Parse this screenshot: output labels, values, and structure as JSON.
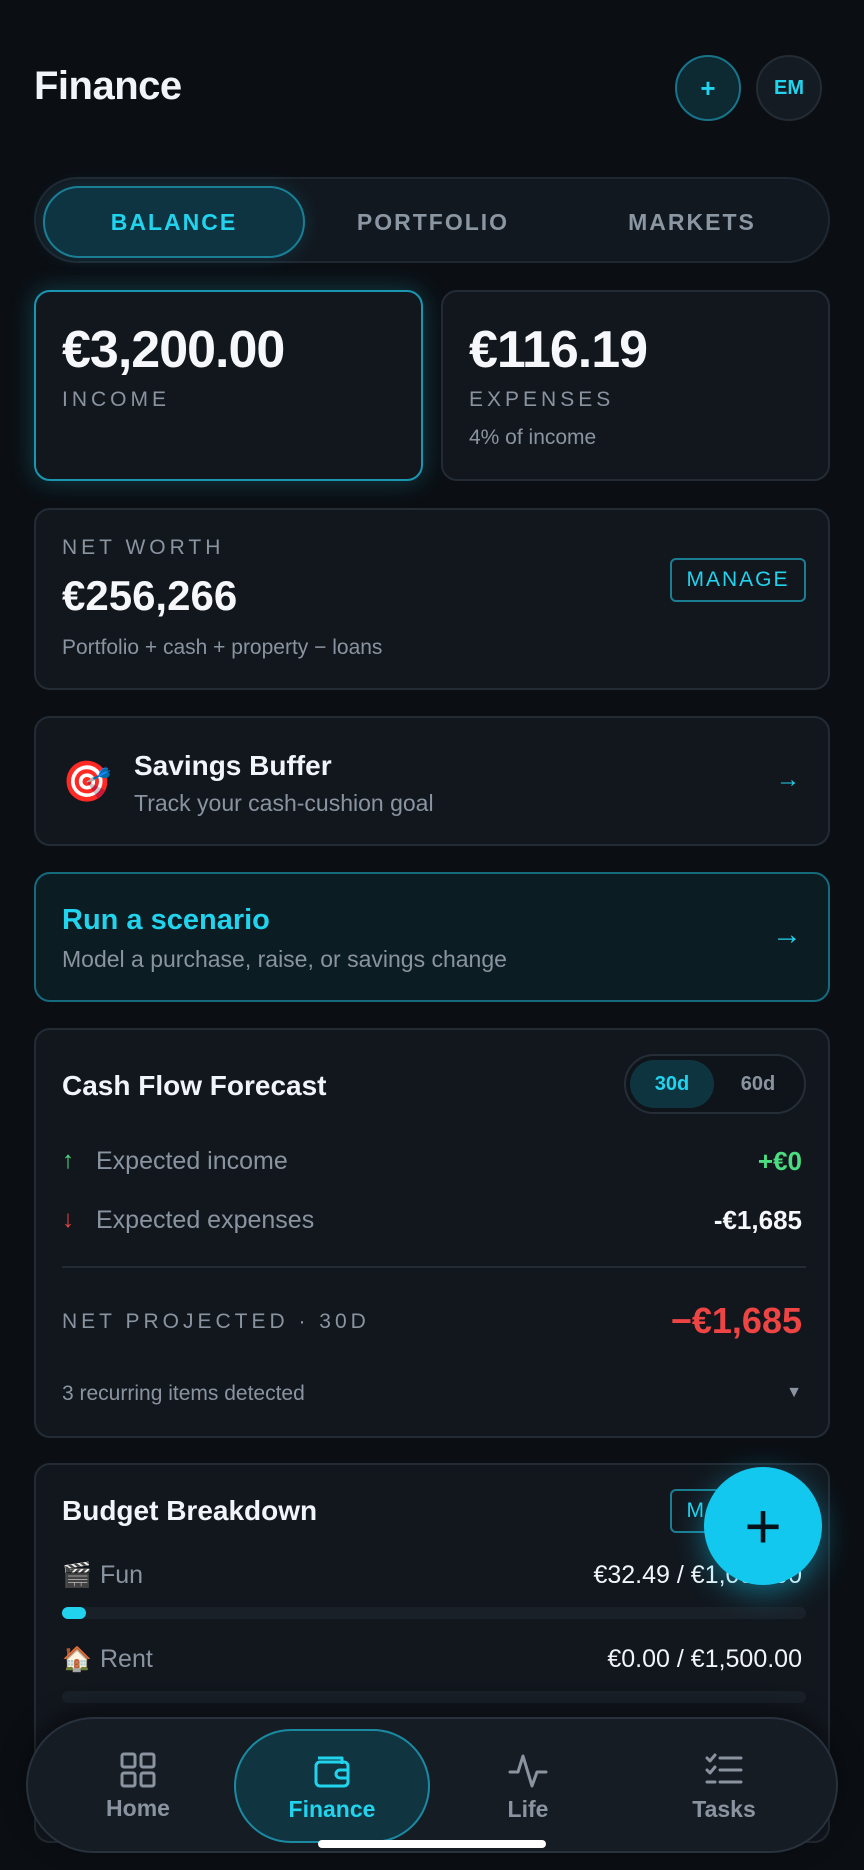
{
  "header": {
    "title": "Finance",
    "add_label": "+",
    "avatar_initials": "EM"
  },
  "tabs": [
    {
      "label": "BALANCE",
      "active": true
    },
    {
      "label": "PORTFOLIO",
      "active": false
    },
    {
      "label": "MARKETS",
      "active": false
    }
  ],
  "income": {
    "amount": "€3,200.00",
    "label": "INCOME"
  },
  "expenses": {
    "amount": "€116.19",
    "label": "EXPENSES",
    "note": "4% of income"
  },
  "net_worth": {
    "label": "NET WORTH",
    "amount": "€256,266",
    "note": "Portfolio + cash + property − loans",
    "manage_label": "MANAGE"
  },
  "savings": {
    "icon": "🎯",
    "title": "Savings Buffer",
    "subtitle": "Track your cash-cushion goal",
    "arrow": "→"
  },
  "scenario": {
    "title": "Run a scenario",
    "subtitle": "Model a purchase, raise, or savings change",
    "arrow": "→"
  },
  "forecast": {
    "title": "Cash Flow Forecast",
    "periods": [
      {
        "label": "30d",
        "active": true
      },
      {
        "label": "60d",
        "active": false
      }
    ],
    "income_arrow": "↑",
    "income_label": "Expected income",
    "income_value": "+€0",
    "expenses_arrow": "↓",
    "expenses_label": "Expected expenses",
    "expenses_value": "-€1,685",
    "net_label": "NET PROJECTED · 30D",
    "net_value": "−€1,685",
    "recurring_note": "3 recurring items detected",
    "expand_glyph": "▼"
  },
  "budget": {
    "title": "Budget Breakdown",
    "manage_label": "MANAGE",
    "items": [
      {
        "icon": "🎬",
        "name": "Fun",
        "amount": "€32.49 / €1,000.00",
        "progress": 0.0325
      },
      {
        "icon": "🏠",
        "name": "Rent",
        "amount": "€0.00 / €1,500.00",
        "progress": 0
      }
    ]
  },
  "fab": {
    "label": "+"
  },
  "nav": [
    {
      "label": "Home",
      "icon": "grid-icon",
      "active": false
    },
    {
      "label": "Finance",
      "icon": "wallet-icon",
      "active": true
    },
    {
      "label": "Life",
      "icon": "pulse-icon",
      "active": false
    },
    {
      "label": "Tasks",
      "icon": "checklist-icon",
      "active": false
    }
  ],
  "colors": {
    "accent": "#22d3ee",
    "positive": "#4ade80",
    "negative": "#ef4444",
    "background": "#0b0f14",
    "card": "#12171e"
  }
}
